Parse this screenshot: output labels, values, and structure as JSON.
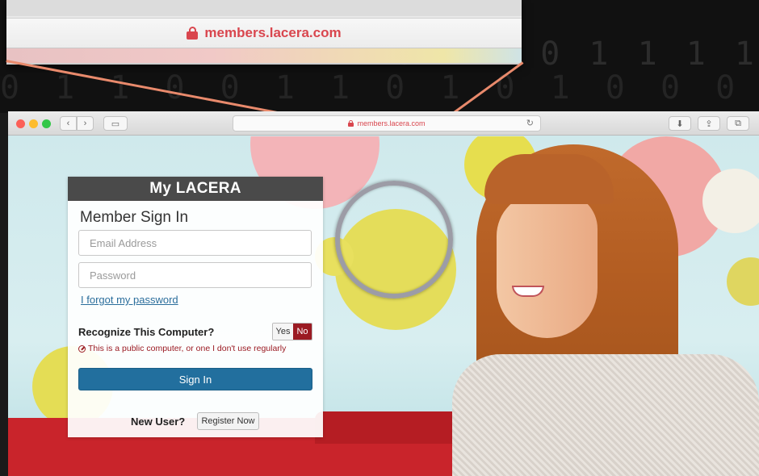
{
  "callout": {
    "url": "members.lacera.com"
  },
  "browser": {
    "url": "members.lacera.com",
    "buttons": {
      "back": "‹",
      "forward": "›",
      "reload": "↻",
      "download": "⬇",
      "share": "⇪",
      "tabs": "⧉",
      "sidebar": "▭"
    }
  },
  "login": {
    "logo": "My LACERA",
    "title": "Member Sign In",
    "email_placeholder": "Email Address",
    "password_placeholder": "Password",
    "forgot": "I forgot my password",
    "recognize_label": "Recognize This Computer?",
    "toggle_yes": "Yes",
    "toggle_no": "No",
    "warning": "This is a public computer, or one I don't use regularly",
    "signin": "Sign In",
    "new_user": "New User?",
    "register": "Register Now"
  },
  "colors": {
    "url_red": "#d9464e",
    "signin_blue": "#226f9e",
    "no_red": "#9b1b23",
    "header_dark": "#4a4a4a",
    "callout_line": "#e98a6c"
  },
  "icons": [
    "lock-icon",
    "reload-icon",
    "download-icon",
    "share-icon",
    "tabs-icon",
    "sidebar-icon",
    "ban-icon"
  ]
}
